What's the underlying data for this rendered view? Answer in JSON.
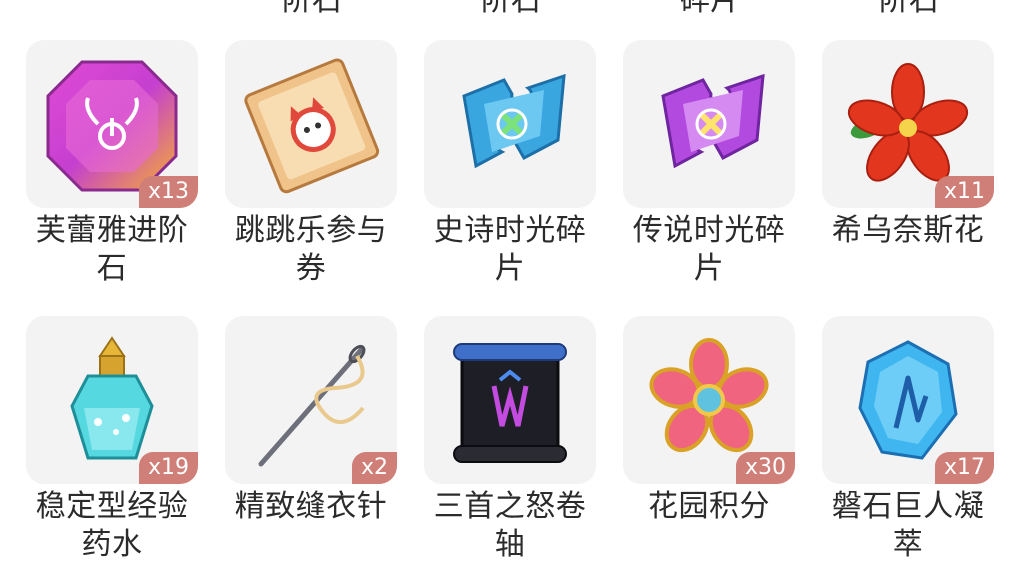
{
  "top_row": [
    "阶石",
    "阶石",
    "碎片",
    "阶石"
  ],
  "items": [
    {
      "name": "芙蕾雅进阶\n石",
      "qty": "x13",
      "icon": "gem-octagon-icon"
    },
    {
      "name": "跳跳乐参与\n券",
      "qty": "",
      "icon": "ticket-icon"
    },
    {
      "name": "史诗时光碎\n片",
      "qty": "",
      "icon": "blue-puzzle-icon"
    },
    {
      "name": "传说时光碎\n片",
      "qty": "",
      "icon": "purple-puzzle-icon"
    },
    {
      "name": "希乌奈斯花",
      "qty": "x11",
      "icon": "red-flower-icon"
    },
    {
      "name": "稳定型经验\n药水",
      "qty": "x19",
      "icon": "potion-icon"
    },
    {
      "name": "精致缝衣针",
      "qty": "x2",
      "icon": "needle-icon"
    },
    {
      "name": "三首之怒卷\n轴",
      "qty": "",
      "icon": "scroll-icon"
    },
    {
      "name": "花园积分",
      "qty": "x30",
      "icon": "flower-badge-icon"
    },
    {
      "name": "磐石巨人凝\n萃",
      "qty": "x17",
      "icon": "crystal-icon"
    }
  ]
}
